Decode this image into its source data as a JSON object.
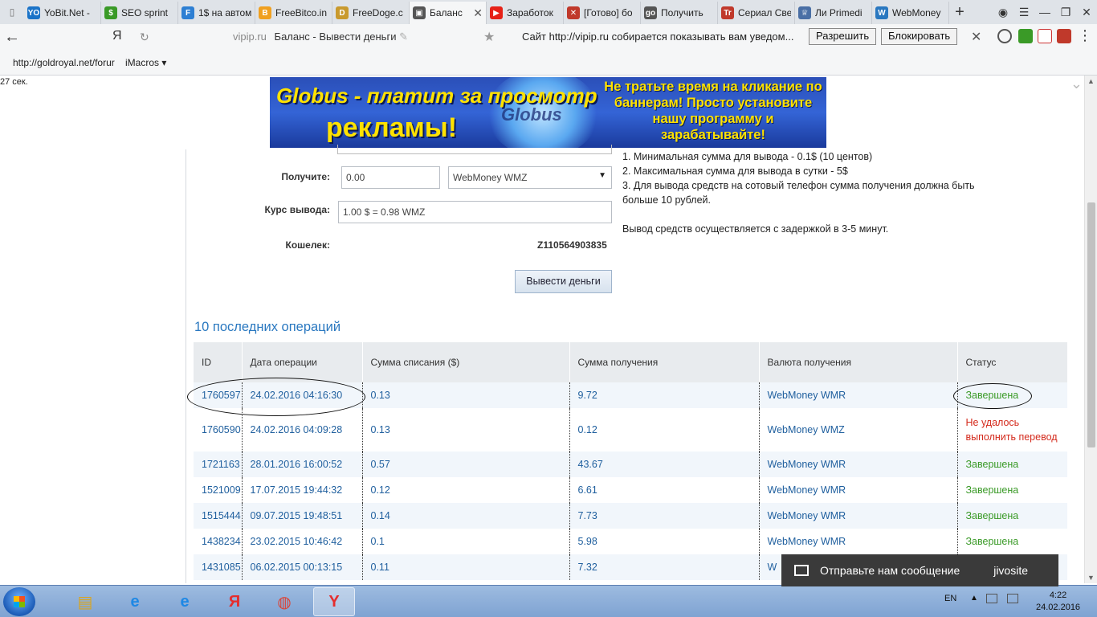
{
  "tabs": [
    {
      "title": "YoBit.Net -",
      "color": "#1a73c8",
      "glyph": "YO"
    },
    {
      "title": "SEO sprint",
      "color": "#3a9a27",
      "glyph": "$"
    },
    {
      "title": "1$ на автом",
      "color": "#2d7fd3",
      "glyph": "F"
    },
    {
      "title": "FreeBitco.in",
      "color": "#f0a020",
      "glyph": "B"
    },
    {
      "title": "FreeDoge.c",
      "color": "#c99a2e",
      "glyph": "D"
    },
    {
      "title": "Баланс",
      "color": "#555555",
      "glyph": "▣",
      "active": true
    },
    {
      "title": "Заработок",
      "color": "#e62117",
      "glyph": "▶"
    },
    {
      "title": "[Готово] бо",
      "color": "#c0392b",
      "glyph": "✕"
    },
    {
      "title": "Получить",
      "color": "#555555",
      "glyph": "go"
    },
    {
      "title": "Сериал Све",
      "color": "#c0392b",
      "glyph": "Tr"
    },
    {
      "title": "Ли Primedi",
      "color": "#4a6fa5",
      "glyph": "♕"
    },
    {
      "title": "WebMoney",
      "color": "#2a78c0",
      "glyph": "W"
    }
  ],
  "address": {
    "yandex": "Я",
    "host": "vipip.ru",
    "title": "Баланс - Вывести деньги"
  },
  "notification": {
    "text": "Сайт http://vipip.ru собирается показывать вам уведом...",
    "allow": "Разрешить",
    "block": "Блокировать"
  },
  "bookmarks": {
    "item1": "http://goldroyal.net/forur",
    "item2": "iMacros ▾"
  },
  "timer": "27 сек.",
  "banner": {
    "line1": "Globus - платит за просмотр",
    "line2": "рекламы!",
    "logo": "Globus",
    "right": "Не тратьте время на кликание по баннерам! Просто установите нашу программу и зарабатывайте!"
  },
  "form": {
    "receive_label": "Получите:",
    "receive_value": "0.00",
    "currency": "WebMoney WMZ",
    "rate_label": "Курс вывода:",
    "rate_value": "1.00 $ = 0.98 WMZ",
    "wallet_label": "Кошелек:",
    "wallet_value": "Z110564903835",
    "submit": "Вывести деньги"
  },
  "info": {
    "l1": "1. Минимальная сумма для вывода - 0.1$ (10 центов)",
    "l2": "2. Максимальная сумма для вывода в сутки - 5$",
    "l3": "3. Для вывода средств на сотовый телефон сумма получения должна быть больше 10 рублей.",
    "l4": "Вывод средств осуществляется с задержкой в 3-5 минут."
  },
  "ops": {
    "title": "10 последних операций",
    "headers": [
      "ID",
      "Дата операции",
      "Сумма списания ($)",
      "Сумма получения",
      "Валюта получения",
      "Статус"
    ],
    "rows": [
      {
        "id": "1760597",
        "date": "24.02.2016 04:16:30",
        "debit": "0.13",
        "received": "9.72",
        "currency": "WebMoney WMR",
        "status": "Завершена",
        "ok": true
      },
      {
        "id": "1760590",
        "date": "24.02.2016 04:09:28",
        "debit": "0.13",
        "received": "0.12",
        "currency": "WebMoney WMZ",
        "status": "Не удалось выполнить перевод",
        "ok": false
      },
      {
        "id": "1721163",
        "date": "28.01.2016 16:00:52",
        "debit": "0.57",
        "received": "43.67",
        "currency": "WebMoney WMR",
        "status": "Завершена",
        "ok": true
      },
      {
        "id": "1521009",
        "date": "17.07.2015 19:44:32",
        "debit": "0.12",
        "received": "6.61",
        "currency": "WebMoney WMR",
        "status": "Завершена",
        "ok": true
      },
      {
        "id": "1515444",
        "date": "09.07.2015 19:48:51",
        "debit": "0.14",
        "received": "7.73",
        "currency": "WebMoney WMR",
        "status": "Завершена",
        "ok": true
      },
      {
        "id": "1438234",
        "date": "23.02.2015 10:46:42",
        "debit": "0.1",
        "received": "5.98",
        "currency": "WebMoney WMR",
        "status": "Завершена",
        "ok": true
      },
      {
        "id": "1431085",
        "date": "06.02.2015 00:13:15",
        "debit": "0.11",
        "received": "7.32",
        "currency": "W",
        "status": "",
        "ok": true
      }
    ]
  },
  "chat": {
    "text": "Отправьте нам сообщение",
    "brand": "jivosite"
  },
  "taskbar": {
    "lang": "EN",
    "time": "4:22",
    "date": "24.02.2016"
  }
}
